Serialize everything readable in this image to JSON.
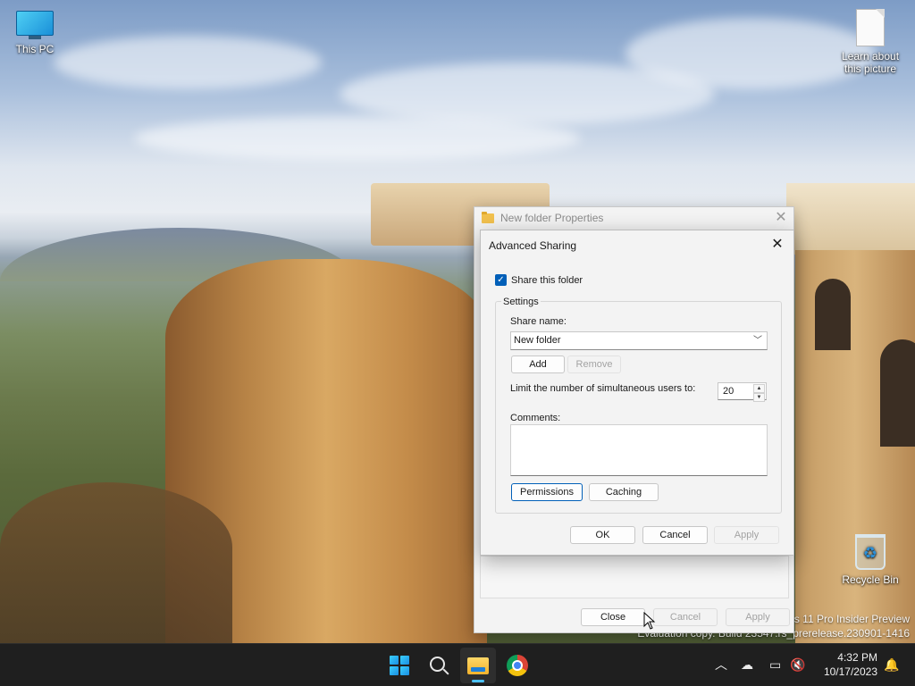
{
  "desktop": {
    "icons": [
      {
        "label": "This PC",
        "icon": "monitor-icon"
      },
      {
        "label": "Learn about this picture",
        "icon": "document-icon"
      },
      {
        "label": "Recycle Bin",
        "icon": "recycle-bin-icon"
      }
    ],
    "watermark": {
      "line1": "ws 11 Pro Insider Preview",
      "line2": "Evaluation copy. Build 23547.rs_prerelease.230901-1416"
    }
  },
  "properties_window": {
    "title": "New folder Properties",
    "icon": "folder-icon",
    "buttons": {
      "close": "Close",
      "cancel": "Cancel",
      "apply": "Apply"
    }
  },
  "advanced_sharing": {
    "title": "Advanced Sharing",
    "share_checkbox": {
      "label": "Share this folder",
      "checked": true
    },
    "settings": {
      "legend": "Settings",
      "share_name_label": "Share name:",
      "share_name_value": "New folder",
      "add_label": "Add",
      "remove_label": "Remove",
      "limit_label": "Limit the number of simultaneous users to:",
      "limit_value": "20",
      "comments_label": "Comments:",
      "comments_value": "",
      "permissions_label": "Permissions",
      "caching_label": "Caching"
    },
    "buttons": {
      "ok": "OK",
      "cancel": "Cancel",
      "apply": "Apply"
    }
  },
  "taskbar": {
    "items": [
      {
        "name": "start",
        "icon": "windows-logo-icon"
      },
      {
        "name": "search",
        "icon": "search-icon"
      },
      {
        "name": "file-explorer",
        "icon": "file-explorer-icon",
        "active": true
      },
      {
        "name": "chrome",
        "icon": "chrome-icon"
      }
    ],
    "tray": {
      "icons": [
        "chevron-up-icon",
        "onedrive-icon",
        "network-icon",
        "volume-muted-icon",
        "notification-icon"
      ],
      "time": "4:32 PM",
      "date": "10/17/2023"
    }
  },
  "colors": {
    "accent": "#005fb8",
    "taskbar": "#1f1f1f",
    "dialog_bg": "#f3f3f3"
  }
}
